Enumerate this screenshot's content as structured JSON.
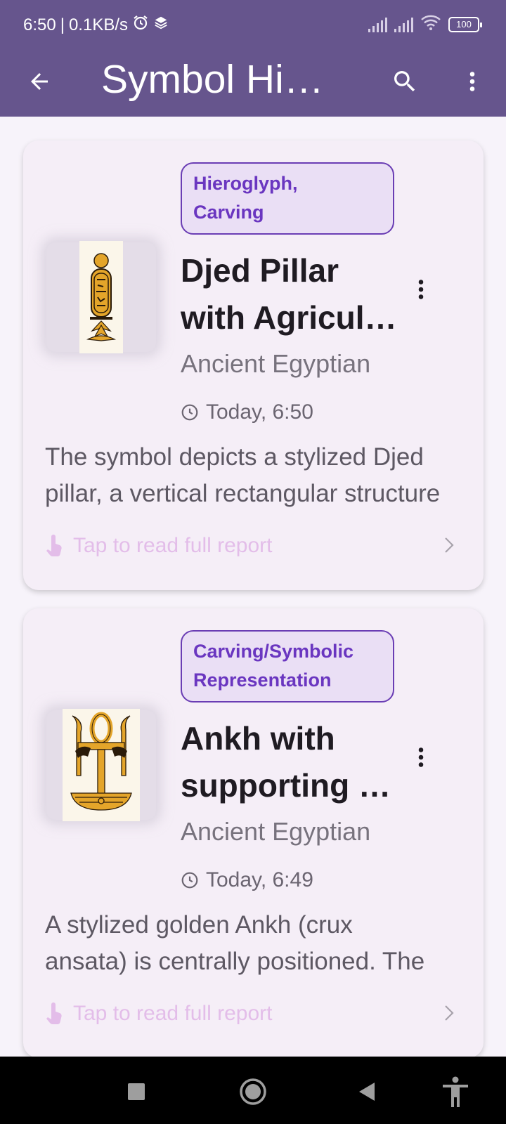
{
  "status_bar": {
    "time": "6:50",
    "separator": "|",
    "speed": "0.1KB/s",
    "battery": "100"
  },
  "app_bar": {
    "title": "Symbol History"
  },
  "cards": [
    {
      "tag": [
        "Hieroglyph,",
        "Carving"
      ],
      "title": [
        "Djed Pillar",
        "with Agricultural Motifs"
      ],
      "culture": "Ancient Egyptian",
      "time": "Today, 6:50",
      "description": [
        "The symbol depicts a stylized Djed",
        "pillar, a vertical rectangular structure"
      ],
      "tap_label": "Tap to read full report"
    },
    {
      "tag": [
        "Carving/Symbolic",
        "Representation"
      ],
      "title": [
        "Ankh with",
        "supporting figures"
      ],
      "culture": "Ancient Egyptian",
      "time": "Today, 6:49",
      "description": [
        "A stylized golden Ankh (crux",
        "ansata) is centrally positioned.  The"
      ],
      "tap_label": "Tap to read full report"
    }
  ],
  "colors": {
    "app_bar": "#66558d",
    "background": "#f7f3fa",
    "card": "#f5eef7",
    "tag_text": "#6a36c0",
    "tag_border": "#6a3db4",
    "tap_text": "#e3bde9"
  }
}
